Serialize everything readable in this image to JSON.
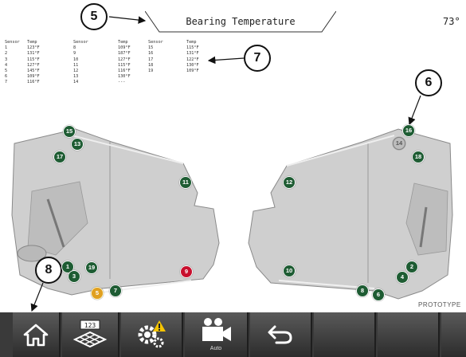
{
  "header": {
    "title": "Bearing Temperature",
    "temperature": "73°"
  },
  "table": {
    "headers": [
      "Sensor",
      "Temp",
      "Sensor",
      "Temp",
      "Sensor",
      "Temp"
    ],
    "col_sensor_a": [
      "1",
      "2",
      "3",
      "4",
      "5",
      "6",
      "7"
    ],
    "col_temp_a": [
      "123°F",
      "131°F",
      "115°F",
      "127°F",
      "145°F",
      "109°F",
      "116°F"
    ],
    "col_sensor_b": [
      "8",
      "9",
      "10",
      "11",
      "12",
      "13",
      "14"
    ],
    "col_temp_b": [
      "109°F",
      "187°F",
      "127°F",
      "115°F",
      "116°F",
      "130°F",
      "---"
    ],
    "col_sensor_c": [
      "15",
      "16",
      "17",
      "18",
      "19"
    ],
    "col_temp_c": [
      "115°F",
      "131°F",
      "122°F",
      "130°F",
      "109°F"
    ]
  },
  "callouts": {
    "c5": "5",
    "c6": "6",
    "c7": "7",
    "c8": "8"
  },
  "sensors": {
    "s1": "1",
    "s2": "2",
    "s3": "3",
    "s4": "4",
    "s5": "5",
    "s6": "6",
    "s7": "7",
    "s8": "8",
    "s9": "9",
    "s10": "10",
    "s11": "11",
    "s12": "12",
    "s13": "13",
    "s14": "14",
    "s15": "15",
    "s16": "16",
    "s17": "17",
    "s18": "18",
    "s19": "19"
  },
  "sensor_status_colors": {
    "normal": "#1e5c33",
    "alarm": "#c8102e",
    "warning": "#e0a020",
    "inactive": "#bdbdbd"
  },
  "prototype_label": "PROTOTYPE",
  "toolbar": {
    "home_icon": "home-icon",
    "grid_label": "123",
    "settings_icon": "gear-warning-icon",
    "camera_label": "Auto",
    "back_icon": "back-arrow-icon"
  }
}
